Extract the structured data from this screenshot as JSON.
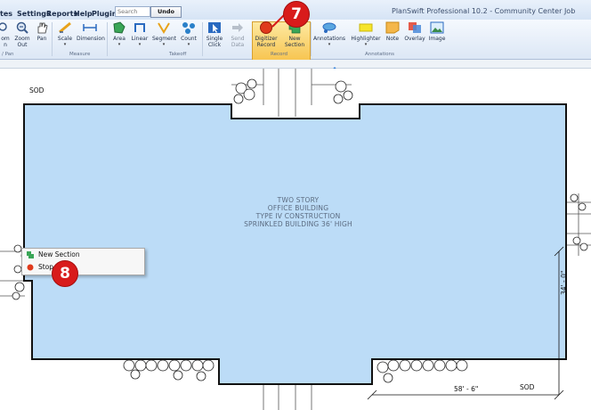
{
  "menu": [
    "tes",
    "Settings",
    "Reports",
    "Help",
    "Plugins"
  ],
  "search": {
    "placeholder": "Search"
  },
  "undo_label": "Undo",
  "app_title": "PlanSwift Professional 10.2 - Community Center Job",
  "ribbon": {
    "buttons": [
      {
        "id": "zoom-in",
        "label": "om",
        "label2": "n"
      },
      {
        "id": "zoom-out",
        "label": "Zoom",
        "label2": "Out"
      },
      {
        "id": "pan",
        "label": "Pan",
        "label2": ""
      },
      {
        "id": "scale",
        "label": "Scale",
        "label2": ""
      },
      {
        "id": "dimension",
        "label": "Dimension",
        "label2": ""
      },
      {
        "id": "area",
        "label": "Area",
        "label2": ""
      },
      {
        "id": "linear",
        "label": "Linear",
        "label2": ""
      },
      {
        "id": "segment",
        "label": "Segment",
        "label2": ""
      },
      {
        "id": "count",
        "label": "Count",
        "label2": ""
      },
      {
        "id": "single-click",
        "label": "Single",
        "label2": "Click"
      },
      {
        "id": "send-data",
        "label": "Send",
        "label2": "Data"
      },
      {
        "id": "digitizer-record",
        "label": "Digitizer",
        "label2": "Record"
      },
      {
        "id": "new-section",
        "label": "New",
        "label2": "Section"
      },
      {
        "id": "annotations",
        "label": "Annotations",
        "label2": ""
      },
      {
        "id": "highlighter",
        "label": "Highlighter",
        "label2": ""
      },
      {
        "id": "note",
        "label": "Note",
        "label2": ""
      },
      {
        "id": "overlay",
        "label": "Overlay",
        "label2": ""
      },
      {
        "id": "image",
        "label": "Image",
        "label2": ""
      }
    ],
    "groups": [
      "/ Pan",
      "Measure",
      "Takeoff",
      "Record",
      "Annotations"
    ]
  },
  "plan": {
    "sod_top": "SOD",
    "sod_bottom": "SOD",
    "building_lines": [
      "TWO STORY",
      "OFFICE BUILDING",
      "TYPE IV CONSTRUCTION",
      "SPRINKLED BUILDING 36' HIGH"
    ],
    "dim_vertical": "34' - 0\"",
    "dim_horizontal": "58' - 6\""
  },
  "context_menu": {
    "items": [
      {
        "label": "New Section",
        "icon": "new-section-icon"
      },
      {
        "label": "Stop",
        "icon": "stop-record-icon"
      }
    ]
  },
  "callouts": [
    "7",
    "8"
  ],
  "colors": {
    "building_fill": "#bcdcf7",
    "record_red": "#e03a1c",
    "callout_red": "#d81b1b"
  }
}
